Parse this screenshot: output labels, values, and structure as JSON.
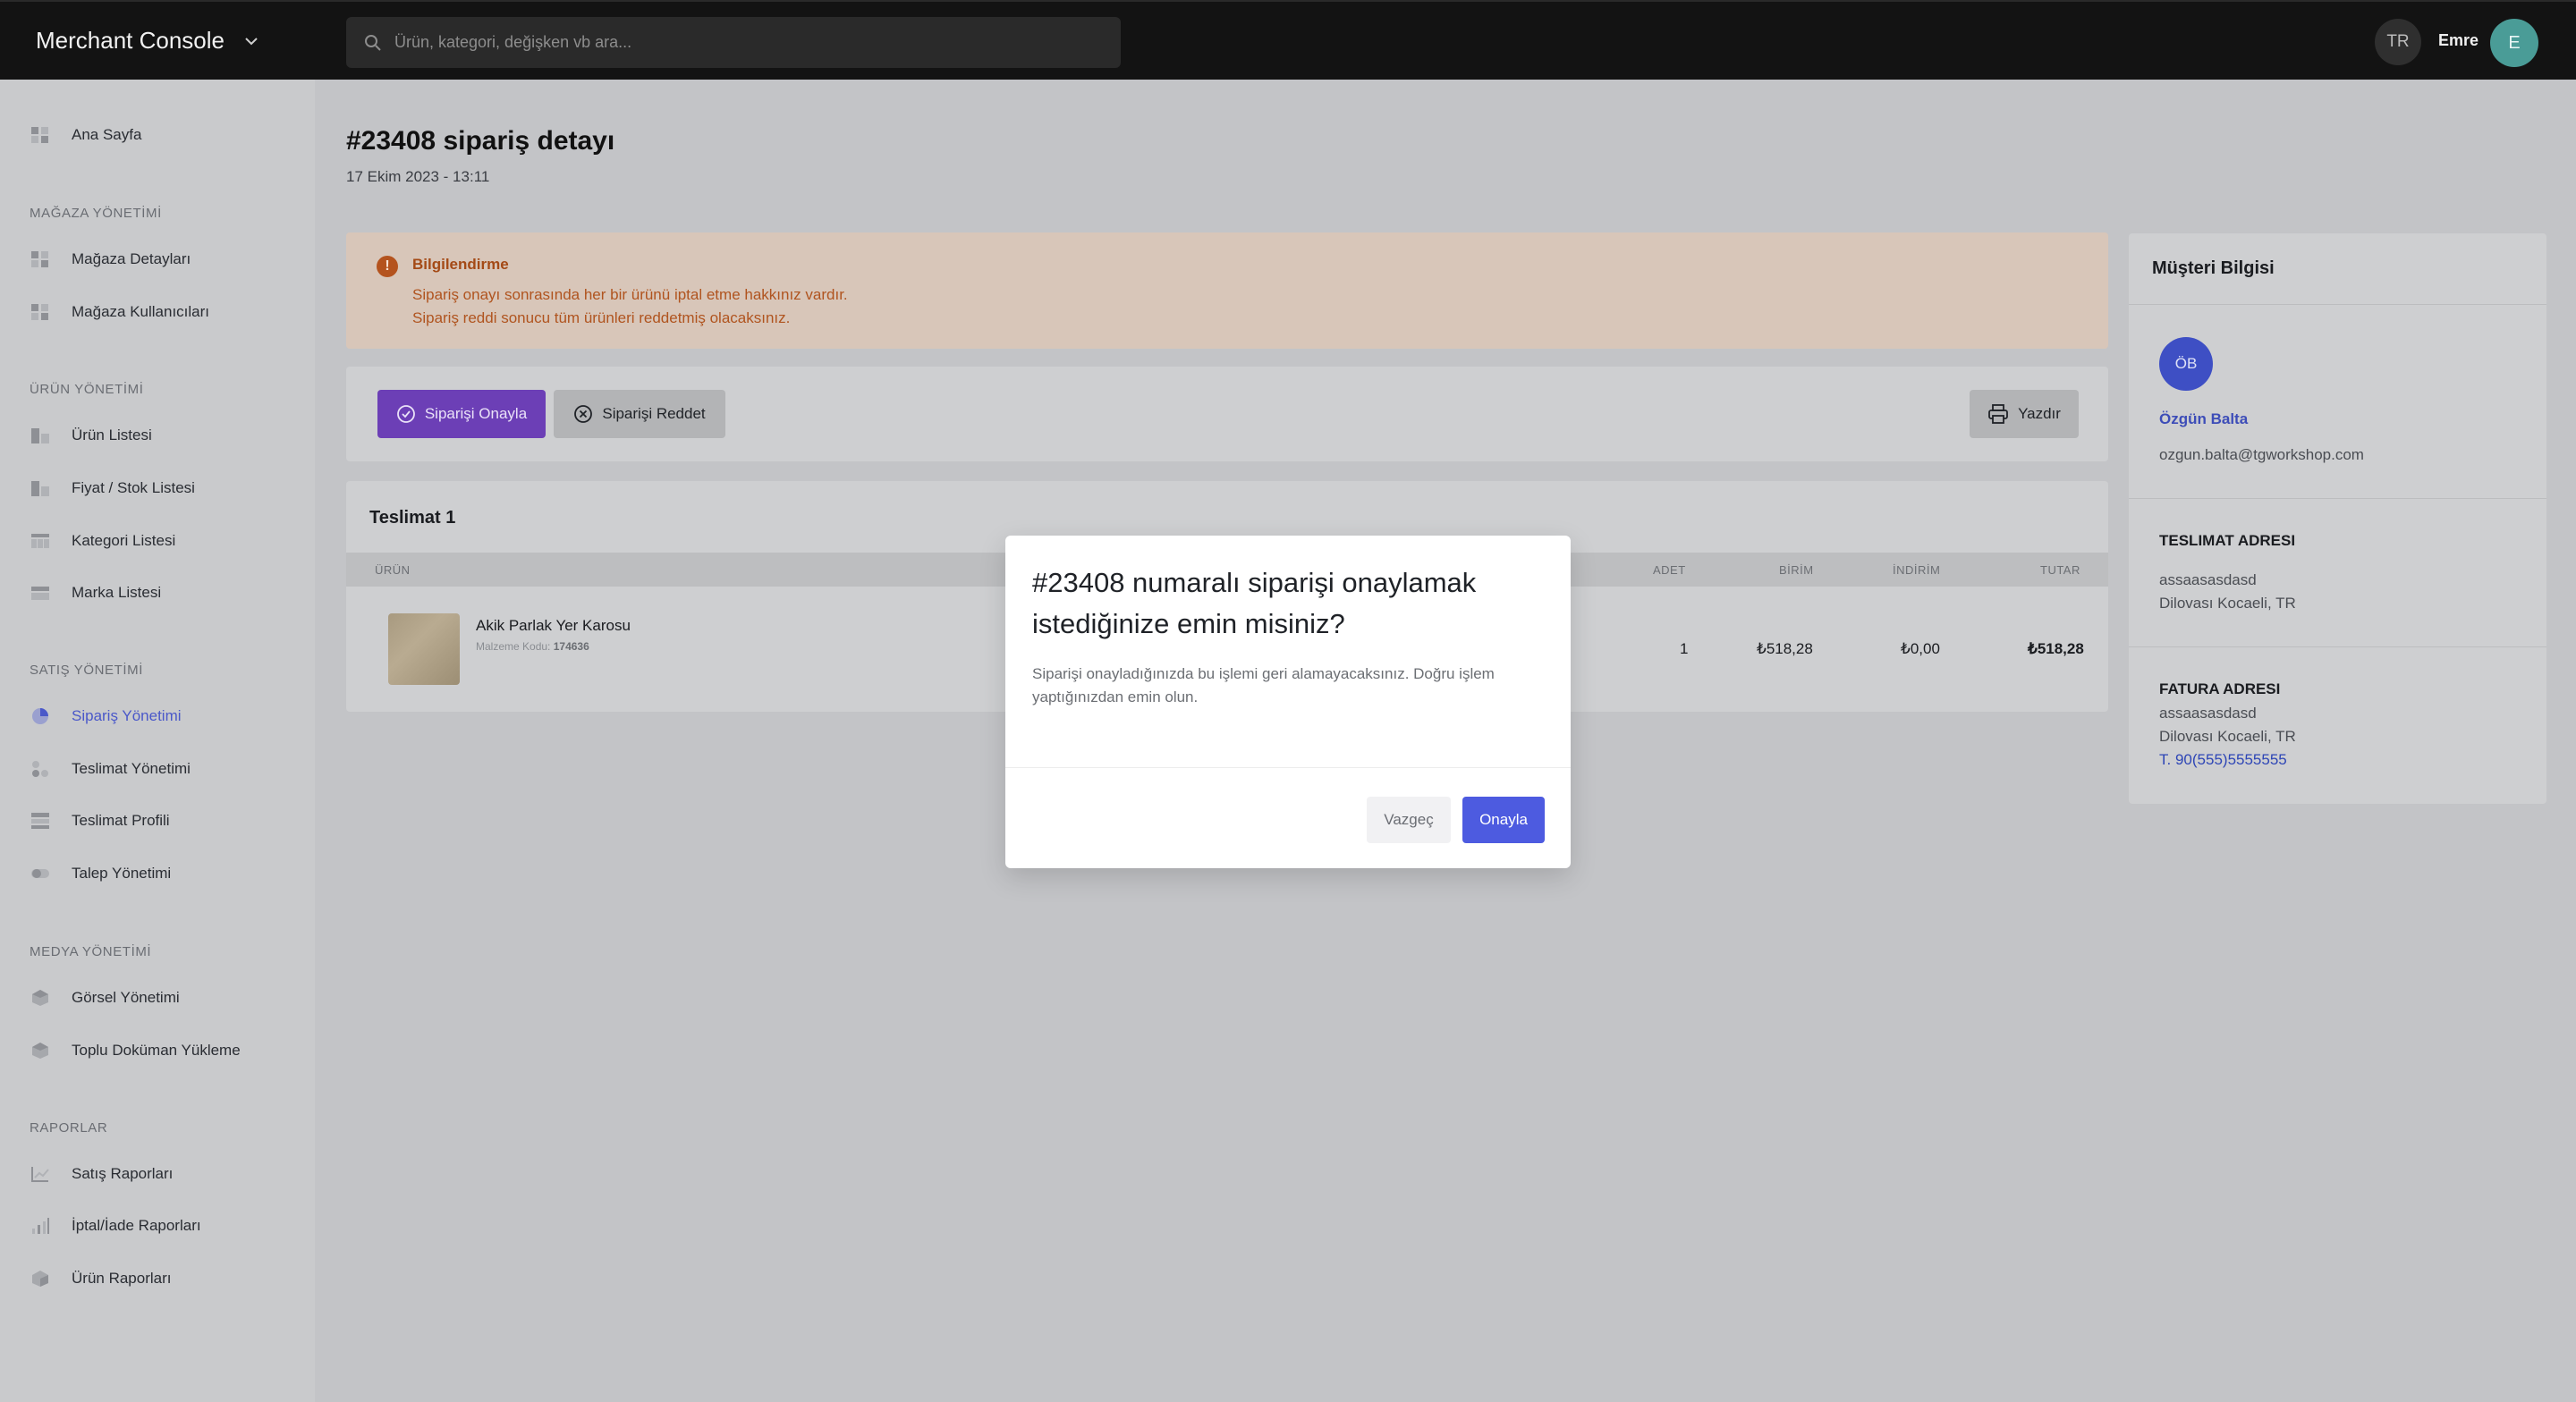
{
  "header": {
    "brand": "Merchant Console",
    "search_placeholder": "Ürün, kategori, değişken vb ara...",
    "language": "TR",
    "user_name": "Emre",
    "user_initial": "E"
  },
  "sidebar": {
    "home": "Ana Sayfa",
    "sections": [
      {
        "title": "MAĞAZA YÖNETİMİ",
        "items": [
          "Mağaza Detayları",
          "Mağaza Kullanıcıları"
        ]
      },
      {
        "title": "ÜRÜN YÖNETİMİ",
        "items": [
          "Ürün Listesi",
          "Fiyat / Stok Listesi",
          "Kategori Listesi",
          "Marka Listesi"
        ]
      },
      {
        "title": "SATIŞ YÖNETİMİ",
        "items": [
          "Sipariş Yönetimi",
          "Teslimat Yönetimi",
          "Teslimat Profili",
          "Talep Yönetimi"
        ]
      },
      {
        "title": "MEDYA YÖNETİMİ",
        "items": [
          "Görsel Yönetimi",
          "Toplu Doküman Yükleme"
        ]
      },
      {
        "title": "RAPORLAR",
        "items": [
          "Satış Raporları",
          "İptal/İade Raporları",
          "Ürün Raporları"
        ]
      }
    ]
  },
  "page": {
    "title": "#23408 sipariş detayı",
    "date": "17 Ekim 2023 - 13:11"
  },
  "alert": {
    "title": "Bilgilendirme",
    "line1": "Sipariş onayı sonrasında her bir ürünü iptal etme hakkınız vardır.",
    "line2": "Sipariş reddi sonucu tüm ürünleri reddetmiş olacaksınız."
  },
  "actions": {
    "approve": "Siparişi Onayla",
    "reject": "Siparişi Reddet",
    "print": "Yazdır"
  },
  "delivery": {
    "title": "Teslimat 1",
    "columns": {
      "product": "ÜRÜN",
      "qty": "ADET",
      "unit": "BİRİM",
      "discount": "İNDİRİM",
      "total": "TUTAR"
    },
    "row": {
      "name": "Akik Parlak Yer Karosu",
      "code_label": "Malzeme Kodu:",
      "code": "174636",
      "qty": "1",
      "unit": "₺518,28",
      "discount": "₺0,00",
      "total": "₺518,28"
    }
  },
  "customer": {
    "heading": "Müşteri Bilgisi",
    "initials": "ÖB",
    "name": "Özgün Balta",
    "email": "ozgun.balta@tgworkshop.com",
    "shipping_title": "TESLIMAT ADRESI",
    "shipping_line1": "assaasasdasd",
    "shipping_line2": "Dilovası Kocaeli, TR",
    "billing_title": "FATURA ADRESI",
    "billing_line1": "assaasasdasd",
    "billing_line2": "Dilovası Kocaeli, TR",
    "phone_prefix": "T.",
    "phone": "90(555)5555555"
  },
  "modal": {
    "title": "#23408 numaralı siparişi onaylamak istediğinize emin misiniz?",
    "text": "Siparişi onayladığınızda bu işlemi geri alamayacaksınız. Doğru işlem yaptığınızdan emin olun.",
    "cancel": "Vazgeç",
    "confirm": "Onayla"
  },
  "colors": {
    "topbar": "#131313",
    "accent_purple": "#6c3fb6",
    "confirm_blue": "#4d5be0",
    "alert_text": "#b0541f"
  }
}
